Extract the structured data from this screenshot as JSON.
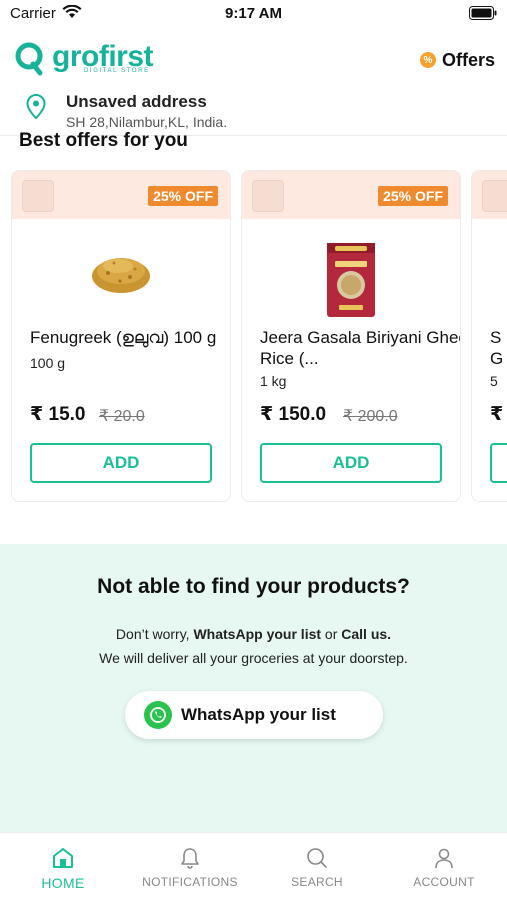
{
  "status_bar": {
    "carrier": "Carrier",
    "time": "9:17 AM"
  },
  "header": {
    "logo_text": "grofirst",
    "logo_subtitle": "DIGITAL STORE",
    "offers_label": "Offers",
    "offers_badge": "%"
  },
  "address": {
    "title": "Unsaved address",
    "line": "SH 28,Nilambur,KL, India."
  },
  "section": {
    "title": "Best offers for you"
  },
  "products": [
    {
      "name": "Fenugreek (ഉലുവ) 100 g",
      "quantity": "100 g",
      "price": "₹ 15.0",
      "mrp": "₹ 20.0",
      "discount": "25% OFF",
      "add_label": "ADD"
    },
    {
      "name": "Jeera Gasala Biriyani Ghee Rice (...",
      "quantity": "1 kg",
      "price": "₹ 150.0",
      "mrp": "₹ 200.0",
      "discount": "25% OFF",
      "add_label": "ADD"
    },
    {
      "name": "S",
      "name_line2": "G",
      "quantity": "5",
      "price": "₹"
    }
  ],
  "find_panel": {
    "title": "Not able to find your products?",
    "line1_prefix": "Don’t worry, ",
    "line1_whatsapp": "WhatsApp your list",
    "line1_or": " or ",
    "line1_call": "Call us.",
    "line2": "We will deliver all your groceries at your doorstep.",
    "button_label": "WhatsApp your list"
  },
  "bottom_nav": [
    {
      "label": "HOME",
      "icon": "home-icon",
      "active": true
    },
    {
      "label": "NOTIFICATIONS",
      "icon": "bell-icon",
      "active": false
    },
    {
      "label": "SEARCH",
      "icon": "search-icon",
      "active": false
    },
    {
      "label": "ACCOUNT",
      "icon": "person-icon",
      "active": false
    }
  ],
  "colors": {
    "brand": "#17b29a",
    "accent_green": "#1bbf96",
    "discount_orange": "#f08a2f",
    "panel_bg": "#e6f8f1",
    "whatsapp": "#2bc24f"
  }
}
